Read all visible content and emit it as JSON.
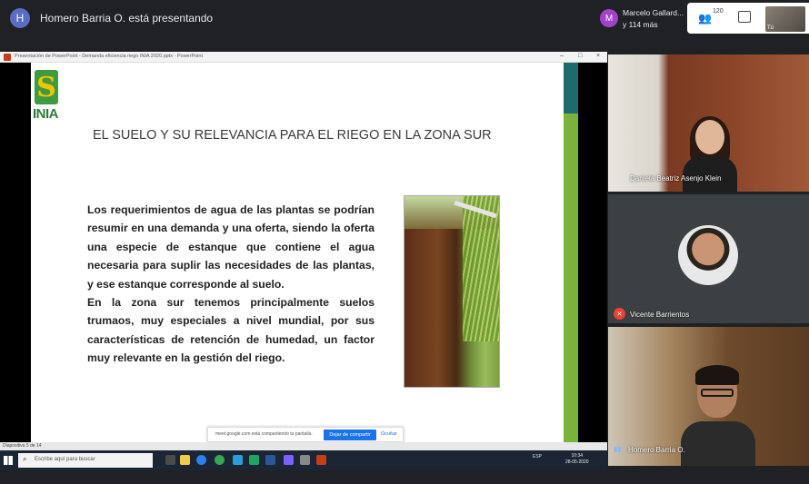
{
  "topbar": {
    "presenter_initial": "H",
    "presenter_text": "Homero Barria O. está presentando",
    "participant_initial": "M",
    "participant_line1": "Marcelo Gallard...",
    "participant_line2": "y 114 más",
    "people_count": "120",
    "self_label": "Tú"
  },
  "ppt": {
    "window_title": "Presentación de PowerPoint - Demanda eficiencia riego INIA 2020.pptx - PowerPoint",
    "status_left": "Diapositiva 5 de 14",
    "logo_text": "INIA",
    "slide_title": "EL SUELO Y SU RELEVANCIA PARA EL RIEGO EN LA ZONA SUR",
    "body_p1": "Los requerimientos de agua de las plantas se podrían resumir en una demanda y una oferta, siendo la oferta una especie de estanque que contiene el agua necesaria para suplir las necesidades de las plantas, y ese estanque corresponde al suelo.",
    "body_p2": "En la zona sur tenemos principalmente suelos trumaos, muy especiales a nivel mundial, por sus características de retención de humedad, un factor muy relevante en la gestión del riego."
  },
  "share_bar": {
    "text": "meet.google.com está compartiendo tu pantalla.",
    "stop_label": "Dejar de compartir",
    "hide_label": "Ocultar"
  },
  "taskbar": {
    "search_placeholder": "Escribe aquí para buscar",
    "tray": "ESP",
    "time": "10:34",
    "date": "28-05-2020"
  },
  "tiles": [
    {
      "name": "Daniela Beatriz Asenjo Klein"
    },
    {
      "name": "Vicente Barrientos"
    },
    {
      "name": "Homero Barria O."
    }
  ]
}
